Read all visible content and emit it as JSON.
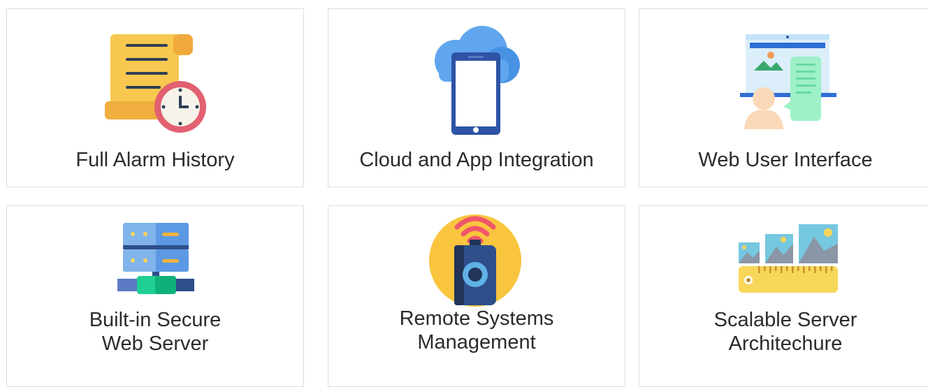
{
  "features": [
    {
      "icon": "alarm-history-icon",
      "lines": [
        "Full Alarm History"
      ]
    },
    {
      "icon": "cloud-app-icon",
      "lines": [
        "Cloud and App Integration"
      ]
    },
    {
      "icon": "web-interface-icon",
      "lines": [
        "Web User Interface"
      ]
    },
    {
      "icon": "secure-server-icon",
      "lines": [
        "Built-in Secure",
        "Web Server"
      ]
    },
    {
      "icon": "remote-management-icon",
      "lines": [
        "Remote Systems",
        "Management"
      ]
    },
    {
      "icon": "scalable-architecture-icon",
      "lines": [
        "Scalable Server",
        "Architechure"
      ]
    }
  ]
}
